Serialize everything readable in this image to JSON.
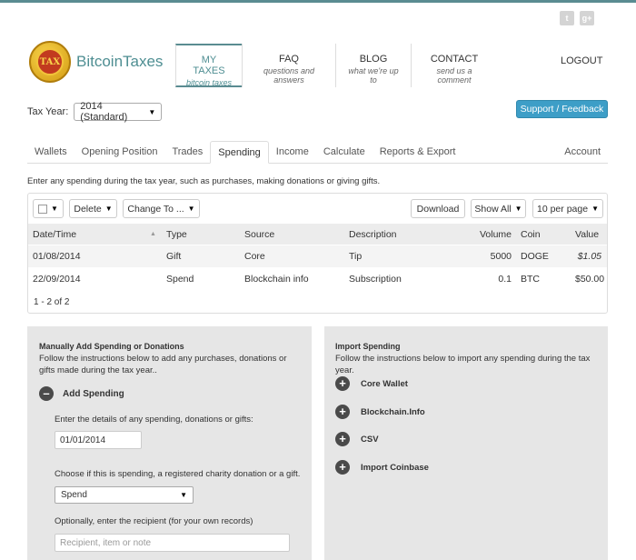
{
  "social": {
    "twitter_glyph": "t",
    "gplus_glyph": "g+"
  },
  "brand": {
    "logo_text": "TAX",
    "name": "BitcoinTaxes"
  },
  "nav": [
    {
      "label": "MY TAXES",
      "sub": "bitcoin taxes"
    },
    {
      "label": "FAQ",
      "sub": "questions and answers"
    },
    {
      "label": "BLOG",
      "sub": "what we're up to"
    },
    {
      "label": "CONTACT",
      "sub": "send us a comment"
    }
  ],
  "logout": "LOGOUT",
  "tax_year": {
    "label": "Tax Year:",
    "selected": "2014 (Standard)"
  },
  "support_button": "Support / Feedback",
  "tabs": [
    "Wallets",
    "Opening Position",
    "Trades",
    "Spending",
    "Income",
    "Calculate",
    "Reports & Export",
    "Account"
  ],
  "intro": "Enter any spending during the tax year, such as purchases, making donations or giving gifts.",
  "toolbar": {
    "delete": "Delete",
    "change_to": "Change To ...",
    "download": "Download",
    "show_all": "Show All",
    "per_page": "10 per page"
  },
  "table": {
    "headers": [
      "Date/Time",
      "Type",
      "Source",
      "Description",
      "Volume",
      "Coin",
      "Value"
    ],
    "rows": [
      [
        "01/08/2014",
        "Gift",
        "Core",
        "Tip",
        "5000",
        "DOGE",
        "$1.05"
      ],
      [
        "22/09/2014",
        "Spend",
        "Blockchain info",
        "Subscription",
        "0.1",
        "BTC",
        "$50.00"
      ]
    ],
    "count": "1 - 2 of 2"
  },
  "manual": {
    "title": "Manually Add Spending or Donations",
    "desc": "Follow the instructions below to add any purchases, donations or gifts made during the tax year..",
    "add_label": "Add Spending",
    "details_text": "Enter the details of any spending, donations or gifts:",
    "date_value": "01/01/2014",
    "choose_text": "Choose if this is spending, a registered charity donation or a gift.",
    "type_selected": "Spend",
    "recipient_text": "Optionally, enter the recipient (for your own records)",
    "recipient_placeholder": "Recipient, item or note"
  },
  "import": {
    "title": "Import Spending",
    "desc": "Follow the instructions below to import any spending during the tax year.",
    "items": [
      "Core Wallet",
      "Blockchain.Info",
      "CSV",
      "Import Coinbase"
    ]
  },
  "colors": {
    "accent": "#5a8c91",
    "support": "#3d9ec7",
    "panel_bg": "#e6e6e6"
  }
}
